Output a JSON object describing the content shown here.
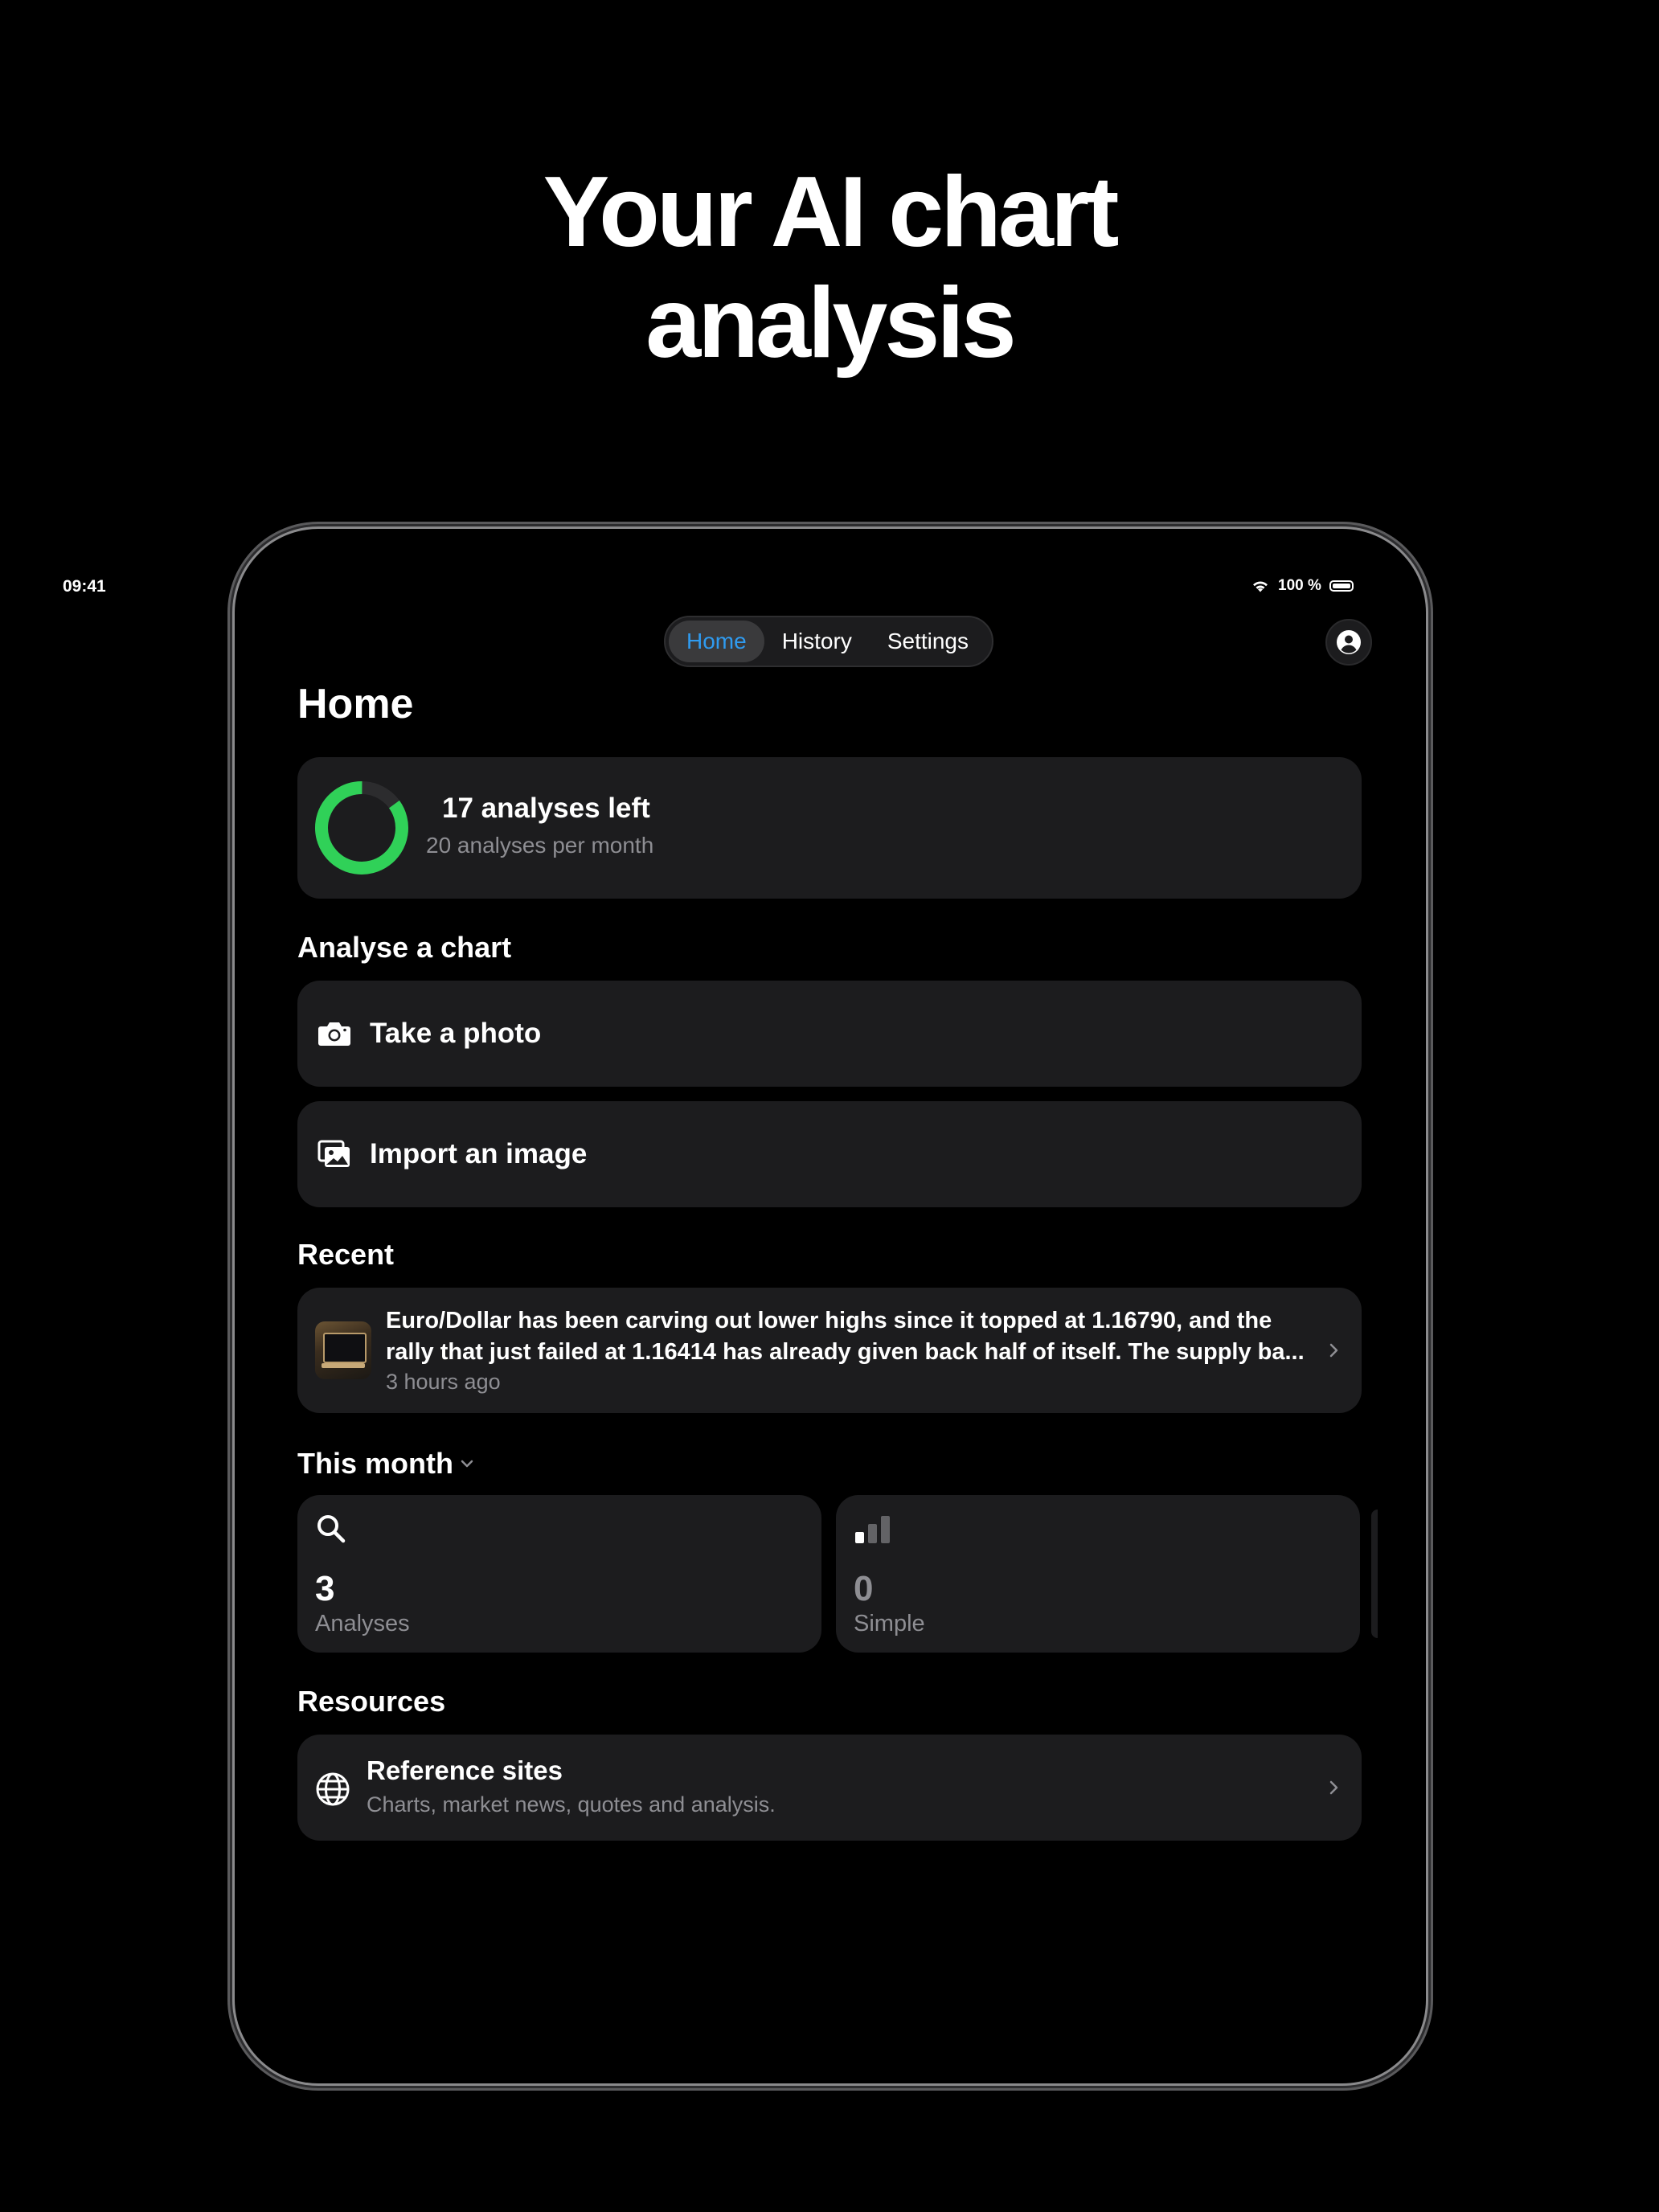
{
  "headline": {
    "line1": "Your AI chart",
    "line2": "analysis"
  },
  "status_bar": {
    "time": "09:41",
    "battery_text": "100 %"
  },
  "nav": {
    "tabs": [
      {
        "label": "Home",
        "active": true
      },
      {
        "label": "History"
      },
      {
        "label": "Settings"
      }
    ]
  },
  "page_title": "Home",
  "usage": {
    "main": "17 analyses left",
    "sub": "20 analyses per month",
    "used": 3,
    "total": 20,
    "ring_color": "#30d158"
  },
  "analyse": {
    "heading": "Analyse a chart",
    "take_photo": "Take a photo",
    "import_image": "Import an image"
  },
  "recent": {
    "heading": "Recent",
    "item": {
      "line1": "Euro/Dollar has been carving out lower highs since it topped at 1.16790, and the",
      "line2": "rally that just failed at 1.16414 has already given back half of itself. The supply ba...",
      "time": "3 hours ago"
    }
  },
  "this_month": {
    "heading": "This month",
    "stats": [
      {
        "value": "3",
        "label": "Analyses",
        "icon": "search-icon"
      },
      {
        "value": "0",
        "label": "Simple",
        "icon": "bar-level-icon"
      }
    ]
  },
  "resources": {
    "heading": "Resources",
    "title": "Reference sites",
    "subtitle": "Charts, market news, quotes and analysis."
  },
  "colors": {
    "accent": "#2f9bf0",
    "background": "#000000",
    "card": "#1c1c1e",
    "secondary_text": "#8e8e93"
  }
}
